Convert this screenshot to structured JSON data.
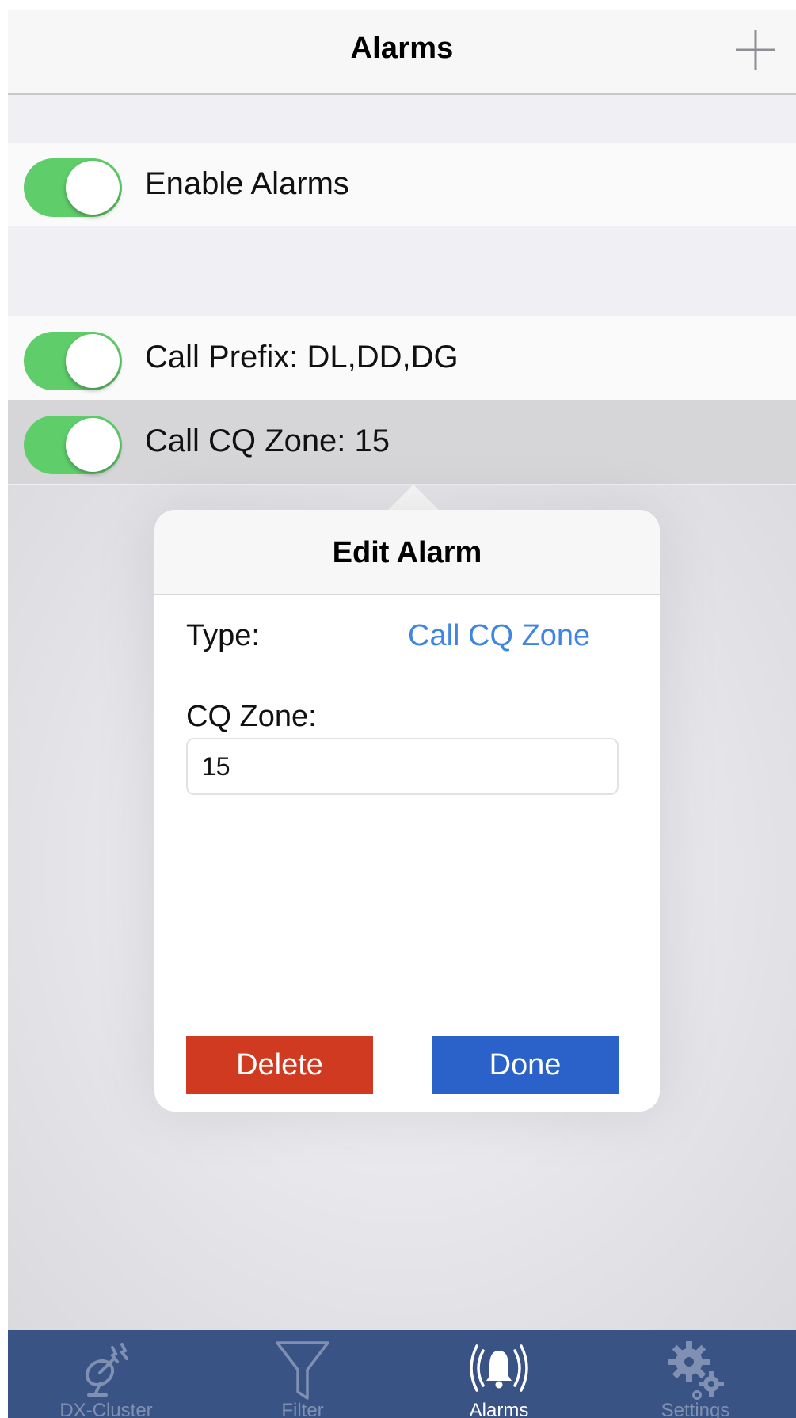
{
  "navbar": {
    "title": "Alarms",
    "add_icon": "plus-icon"
  },
  "settings": {
    "enable_label": "Enable Alarms",
    "enabled": true
  },
  "alarms": [
    {
      "label": "Call Prefix: DL,DD,DG",
      "enabled": true
    },
    {
      "label": "Call CQ Zone: 15",
      "enabled": true,
      "selected": true
    }
  ],
  "popover": {
    "title": "Edit Alarm",
    "type_label": "Type:",
    "type_value": "Call CQ Zone",
    "zone_label": "CQ Zone:",
    "zone_value": "15",
    "delete_label": "Delete",
    "done_label": "Done"
  },
  "tabs": [
    {
      "label": "DX-Cluster",
      "icon": "satellite-dish-icon",
      "active": false
    },
    {
      "label": "Filter",
      "icon": "funnel-icon",
      "active": false
    },
    {
      "label": "Alarms",
      "icon": "bell-icon",
      "active": true
    },
    {
      "label": "Settings",
      "icon": "gears-icon",
      "active": false
    }
  ],
  "colors": {
    "toggle_on": "#5fce6a",
    "link_blue": "#3f86e3",
    "delete_red": "#d03a21",
    "done_blue": "#2b62c9",
    "tabbar_bg": "#3a5385"
  }
}
